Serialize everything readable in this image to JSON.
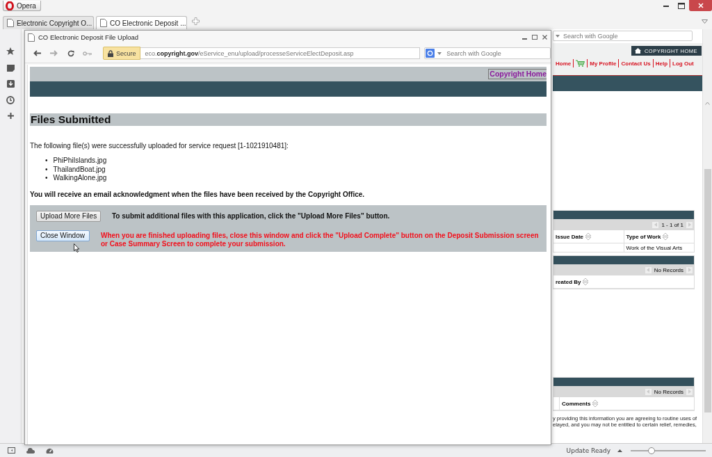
{
  "browser": {
    "app_button": "Opera",
    "tabs": [
      {
        "title": "Electronic Copyright O...",
        "selected": false
      },
      {
        "title": "CO Electronic Deposit ...",
        "selected": true
      }
    ],
    "search_placeholder": "Search with Google"
  },
  "site_header": {
    "home_button": "COPYRIGHT HOME",
    "nav": [
      {
        "kind": "link",
        "label": "Home"
      },
      {
        "kind": "cart"
      },
      {
        "kind": "link",
        "label": "My Profile"
      },
      {
        "kind": "link",
        "label": "Contact Us"
      },
      {
        "kind": "link",
        "label": "Help"
      },
      {
        "kind": "link",
        "label": "Log Out"
      }
    ]
  },
  "tables": [
    {
      "pager": "1 - 1 of 1",
      "columns": [
        "Issue Date",
        "Type of Work"
      ],
      "rows": [
        [
          "",
          "Work of the Visual Arts"
        ]
      ]
    },
    {
      "pager": "No Records",
      "columns": [
        "reated By"
      ]
    },
    {
      "pager": "No Records",
      "columns": [
        "Comments"
      ]
    }
  ],
  "footer_text": [
    "y providing this information you are agreeing to routine uses of",
    "elayed, and you may not be entitled to certain relief, remedies,"
  ],
  "popup": {
    "title": "CO Electronic Deposit File Upload",
    "security_badge": "Secure",
    "url": "eco.**copyright.gov**/eService_enu/upload/processeServiceElectDeposit.asp",
    "search_placeholder": "Search with Google",
    "page": {
      "home_link": "Copyright Home",
      "heading": "Files Submitted",
      "intro": "The following file(s) were successfully uploaded for service request [1-1021910481]:",
      "bullet": "•",
      "files": [
        "PhiPhiIslands.jpg",
        "ThailandBoat.jpg",
        "WalkingAlone.jpg"
      ],
      "notice": "You will receive an email acknowledgment when the files have been received by the Copyright Office.",
      "actions": [
        {
          "kind": "info",
          "button": "Upload More Files",
          "message": "To submit additional files with this application, click the \"Upload More Files\" button.",
          "focused": false
        },
        {
          "kind": "warning",
          "button": "Close Window",
          "message": "When you are finished uploading files, close this window and click the \"Upload Complete\" button on the Deposit Submission screen or Case Summary Screen to complete your submission.",
          "focused": true
        }
      ]
    }
  },
  "status_bar": {
    "update_label": "Update Ready",
    "zoom": {
      "level": 0.28
    }
  }
}
